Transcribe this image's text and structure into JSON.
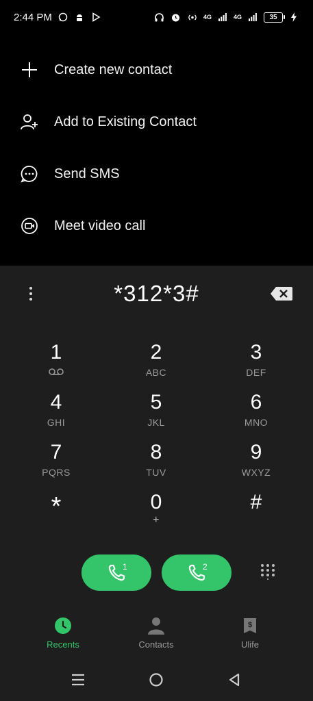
{
  "status_bar": {
    "time": "2:44 PM",
    "network_1": "4G",
    "network_2": "4G",
    "battery": "35"
  },
  "menu": {
    "items": [
      {
        "label": "Create new contact",
        "icon": "plus-icon"
      },
      {
        "label": "Add to Existing Contact",
        "icon": "add-person-icon"
      },
      {
        "label": "Send SMS",
        "icon": "message-icon"
      },
      {
        "label": "Meet video call",
        "icon": "video-call-icon"
      }
    ]
  },
  "dialer": {
    "number": "*312*3#",
    "keys": [
      {
        "digit": "1",
        "letters": ""
      },
      {
        "digit": "2",
        "letters": "ABC"
      },
      {
        "digit": "3",
        "letters": "DEF"
      },
      {
        "digit": "4",
        "letters": "GHI"
      },
      {
        "digit": "5",
        "letters": "JKL"
      },
      {
        "digit": "6",
        "letters": "MNO"
      },
      {
        "digit": "7",
        "letters": "PQRS"
      },
      {
        "digit": "8",
        "letters": "TUV"
      },
      {
        "digit": "9",
        "letters": "WXYZ"
      },
      {
        "digit": "*",
        "letters": ""
      },
      {
        "digit": "0",
        "letters": "+"
      },
      {
        "digit": "#",
        "letters": ""
      }
    ],
    "sim1_label": "1",
    "sim2_label": "2",
    "call_color": "#34c46a"
  },
  "bottom_nav": {
    "tabs": [
      {
        "label": "Recents",
        "icon": "clock-icon",
        "active": true
      },
      {
        "label": "Contacts",
        "icon": "person-icon",
        "active": false
      },
      {
        "label": "Ulife",
        "icon": "wallet-icon",
        "active": false
      }
    ]
  },
  "colors": {
    "accent": "#34c46a",
    "dialer_bg": "#1e1e1e",
    "top_bg": "#000000"
  }
}
